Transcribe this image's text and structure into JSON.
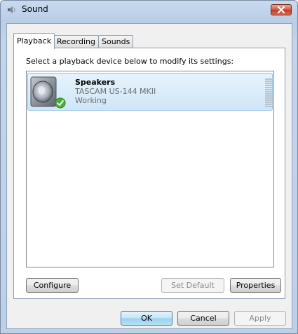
{
  "window": {
    "title": "Sound",
    "close_icon": "close-icon"
  },
  "tabs": [
    {
      "label": "Playback",
      "active": true
    },
    {
      "label": "Recording",
      "active": false
    },
    {
      "label": "Sounds",
      "active": false
    }
  ],
  "panel": {
    "instruction": "Select a playback device below to modify its settings:",
    "devices": [
      {
        "name": "Speakers",
        "model": "TASCAM US-144 MKII",
        "status": "Working",
        "icon": "speaker-icon",
        "badge_icon": "checkmark-icon",
        "selected": true
      }
    ],
    "buttons": {
      "configure": "Configure",
      "set_default": "Set Default",
      "properties": "Properties"
    }
  },
  "dialog_buttons": {
    "ok": "OK",
    "cancel": "Cancel",
    "apply": "Apply"
  },
  "colors": {
    "selection": "#cfe6f8",
    "check_badge": "#4caf3c"
  }
}
